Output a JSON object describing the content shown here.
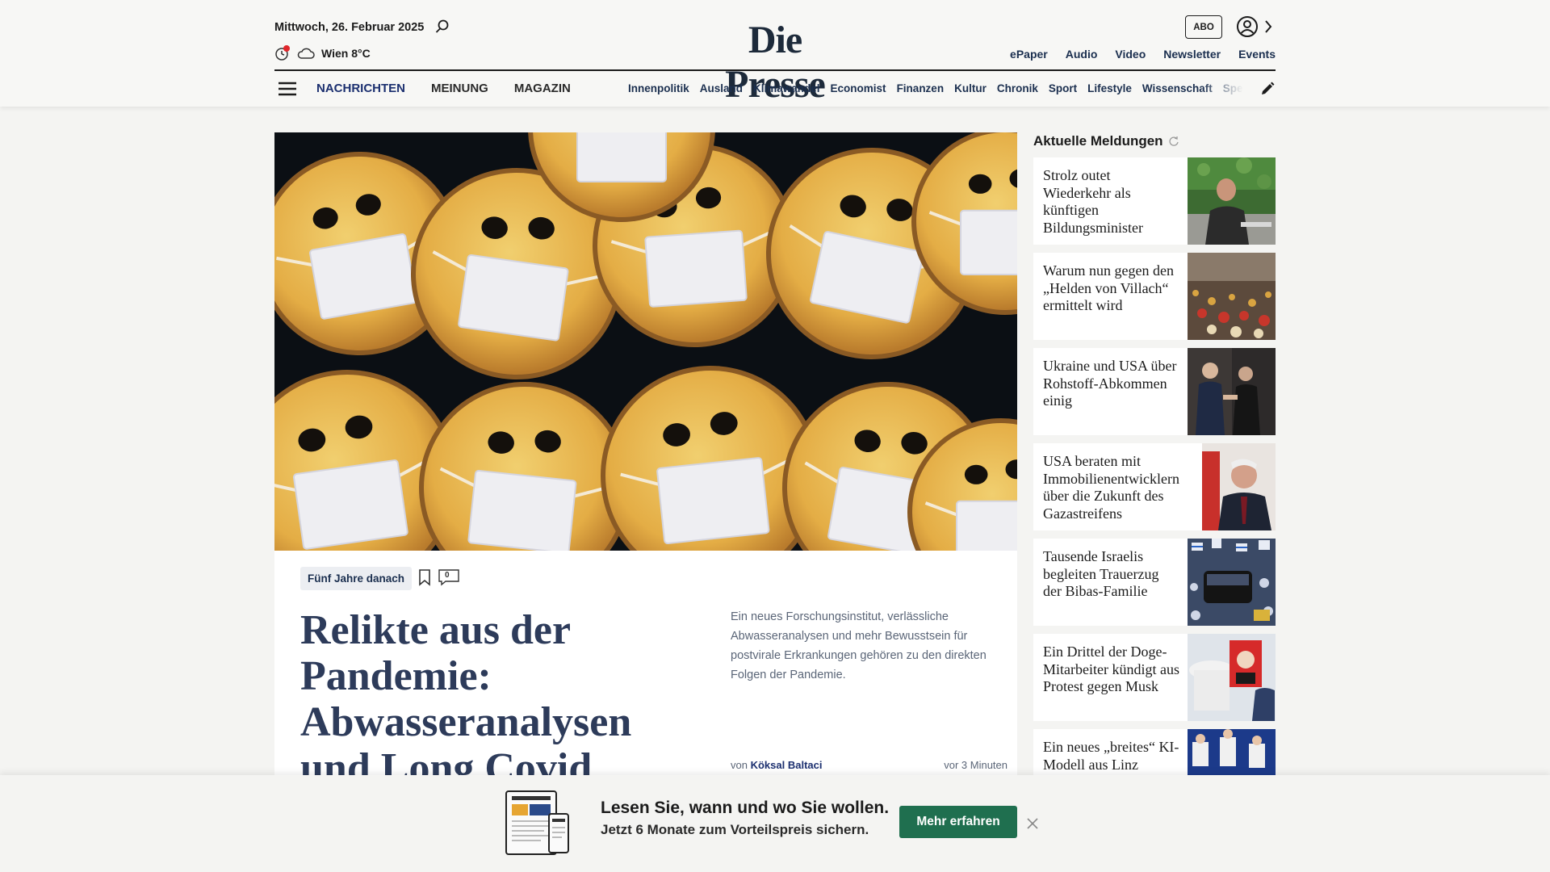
{
  "header": {
    "date": "Mittwoch, 26. Februar 2025",
    "weather": "Wien 8°C",
    "logo": "Die Presse",
    "abo_label": "ABO",
    "top_links": [
      "ePaper",
      "Audio",
      "Video",
      "Newsletter",
      "Events"
    ],
    "main_nav": [
      "NACHRICHTEN",
      "MEINUNG",
      "MAGAZIN"
    ],
    "sub_nav": [
      "Innenpolitik",
      "Ausland",
      "Klimawandel",
      "Economist",
      "Finanzen",
      "Kultur",
      "Chronik",
      "Sport",
      "Lifestyle",
      "Wissenschaft",
      "Spectrum"
    ]
  },
  "article": {
    "tag": "Fünf Jahre danach",
    "comment_count": "0",
    "headline": "Relikte aus der Pandemie: Abwasseranalysen und Long Covid",
    "lead": "Ein neues Forschungsinstitut, verlässliche Abwasseranalysen und mehr Bewusstsein für postvirale Erkrankungen gehören zu den direkten Folgen der Pandemie.",
    "author_prefix": "von",
    "author": "Köksal Baltaci",
    "time": "vor 3 Minuten"
  },
  "sidebar": {
    "title": "Aktuelle Meldungen",
    "items": [
      {
        "text": "Strolz outet Wiederkehr als künftigen Bildungsminister"
      },
      {
        "text": "Warum nun gegen den „Helden von Villach“ ermittelt wird"
      },
      {
        "text": "Ukraine und USA über Rohstoff-Abkommen einig"
      },
      {
        "text": "USA beraten mit Immobilienentwicklern über die Zukunft des Gazastreifens"
      },
      {
        "text": "Tausende Israelis begleiten Trauerzug der Bibas-Familie"
      },
      {
        "text": "Ein Drittel der Doge-Mitarbeiter kündigt aus Protest gegen Musk"
      },
      {
        "text": "Ein neues „breites“ KI-Modell aus Linz"
      }
    ]
  },
  "promo": {
    "line1": "Lesen Sie, wann und wo Sie wollen.",
    "line2": "Jetzt 6 Monate zum Vorteilspreis sichern.",
    "button": "Mehr erfahren"
  },
  "colors": {
    "brand_navy": "#1d2a3a",
    "headline_blue": "#2d3b5a",
    "cta_green": "#1f6f4f",
    "notification_red": "#e0262b"
  }
}
